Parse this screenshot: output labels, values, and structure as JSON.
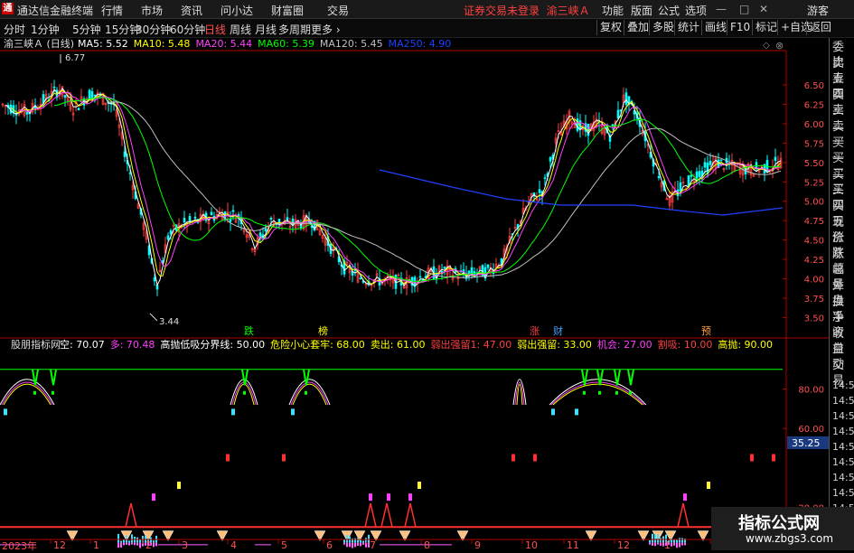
{
  "app": {
    "title": "通达信金融终端",
    "menu": [
      "行情",
      "市场",
      "资讯",
      "问小达",
      "财富圈",
      "交易"
    ],
    "warning": "证券交易未登录",
    "stock": "渝三峡Ａ",
    "right_menu": [
      "功能",
      "版面",
      "公式",
      "选项"
    ],
    "guest": "游客",
    "r_badge": "R"
  },
  "toolbar": {
    "timeframes": [
      "分时",
      "1分钟",
      "5分钟",
      "15分钟",
      "30分钟",
      "60分钟",
      "日线",
      "周线",
      "月线",
      "多周期",
      "更多"
    ],
    "active": "日线",
    "buttons": [
      "复权",
      "叠加",
      "多股",
      "统计",
      "画线",
      "F10",
      "标记",
      "+自选",
      "返回"
    ]
  },
  "main": {
    "title": "渝三峡Ａ (日线)",
    "ma": [
      {
        "label": "MA5: 5.52",
        "color": "#ffffff"
      },
      {
        "label": "MA10: 5.48",
        "color": "#ffff00"
      },
      {
        "label": "MA20: 5.44",
        "color": "#ff40ff"
      },
      {
        "label": "MA60: 5.39",
        "color": "#00ff00"
      },
      {
        "label": "MA120: 5.45",
        "color": "#c0c0c0"
      },
      {
        "label": "MA250: 4.90",
        "color": "#2040ff"
      }
    ],
    "high_label": "6.77",
    "low_label": "3.44",
    "markers": [
      {
        "text": "跌",
        "color": "#00ff00"
      },
      {
        "text": "榜",
        "color": "#ffff00"
      },
      {
        "text": "涨",
        "color": "#ff4040"
      },
      {
        "text": "财",
        "color": "#40a0ff"
      },
      {
        "text": "预",
        "color": "#ffa040"
      }
    ]
  },
  "indicator": {
    "name": "股朋指标网",
    "items": [
      {
        "label": "空: 70.07",
        "color": "#ffffff"
      },
      {
        "label": "多: 70.48",
        "color": "#ff40ff"
      },
      {
        "label": "高抛低吸分界线: 50.00",
        "color": "#ffffff"
      },
      {
        "label": "危险小心套牢: 68.00",
        "color": "#ffff00"
      },
      {
        "label": "卖出: 61.00",
        "color": "#ffff00"
      },
      {
        "label": "弱出强留1: 47.00",
        "color": "#ff4040"
      },
      {
        "label": "弱出强留: 33.00",
        "color": "#ffff00"
      },
      {
        "label": "机会: 27.00",
        "color": "#ff40ff"
      },
      {
        "label": "割吸: 10.00",
        "color": "#ff4040"
      },
      {
        "label": "高抛: 90.00",
        "color": "#ffff00"
      }
    ],
    "value_badge": "35.25"
  },
  "side": {
    "items": [
      {
        "t": "委比",
        "c": "normal"
      },
      {
        "t": "卖五",
        "c": "normal"
      },
      {
        "t": "卖四",
        "c": "normal"
      },
      {
        "t": "卖三",
        "c": "normal"
      },
      {
        "t": "卖二",
        "c": "normal"
      },
      {
        "t": "卖一",
        "c": "normal"
      },
      {
        "t": "买一",
        "c": "normal"
      },
      {
        "t": "买二",
        "c": "normal"
      },
      {
        "t": "买三",
        "c": "normal"
      },
      {
        "t": "买四",
        "c": "normal"
      },
      {
        "t": "买五",
        "c": "normal"
      },
      {
        "t": "现价",
        "c": "normal"
      },
      {
        "t": "涨跌",
        "c": "normal"
      },
      {
        "t": "涨幅",
        "c": "normal"
      },
      {
        "t": "总量",
        "c": "normal"
      },
      {
        "t": "外盘",
        "c": "normal"
      },
      {
        "t": "换手",
        "c": "normal"
      },
      {
        "t": "净资",
        "c": "normal"
      },
      {
        "t": "收益",
        "c": "normal"
      },
      {
        "t": "自动",
        "c": "normal"
      },
      {
        "t": "交易",
        "c": "normal"
      }
    ],
    "times": [
      "14:55",
      "14:55",
      "14:55",
      "14:56",
      "14:56",
      "14:56",
      "14:56",
      "14:56",
      "14:56"
    ]
  },
  "axis": {
    "price_ticks": [
      "6.50",
      "6.25",
      "6.00",
      "5.75",
      "5.50",
      "5.25",
      "5.00",
      "4.75",
      "4.50",
      "4.25",
      "4.00",
      "3.75",
      "3.50"
    ],
    "ind_ticks": [
      "80.00",
      "60.00",
      "20.00"
    ],
    "year": "2023年",
    "months": [
      "12",
      "1",
      "2",
      "3",
      "4",
      "5",
      "6",
      "7",
      "8",
      "9",
      "10",
      "11",
      "12",
      "1",
      "2"
    ]
  },
  "watermark": {
    "line1": "指标公式网",
    "line2": "www.zbgs3.com"
  }
}
